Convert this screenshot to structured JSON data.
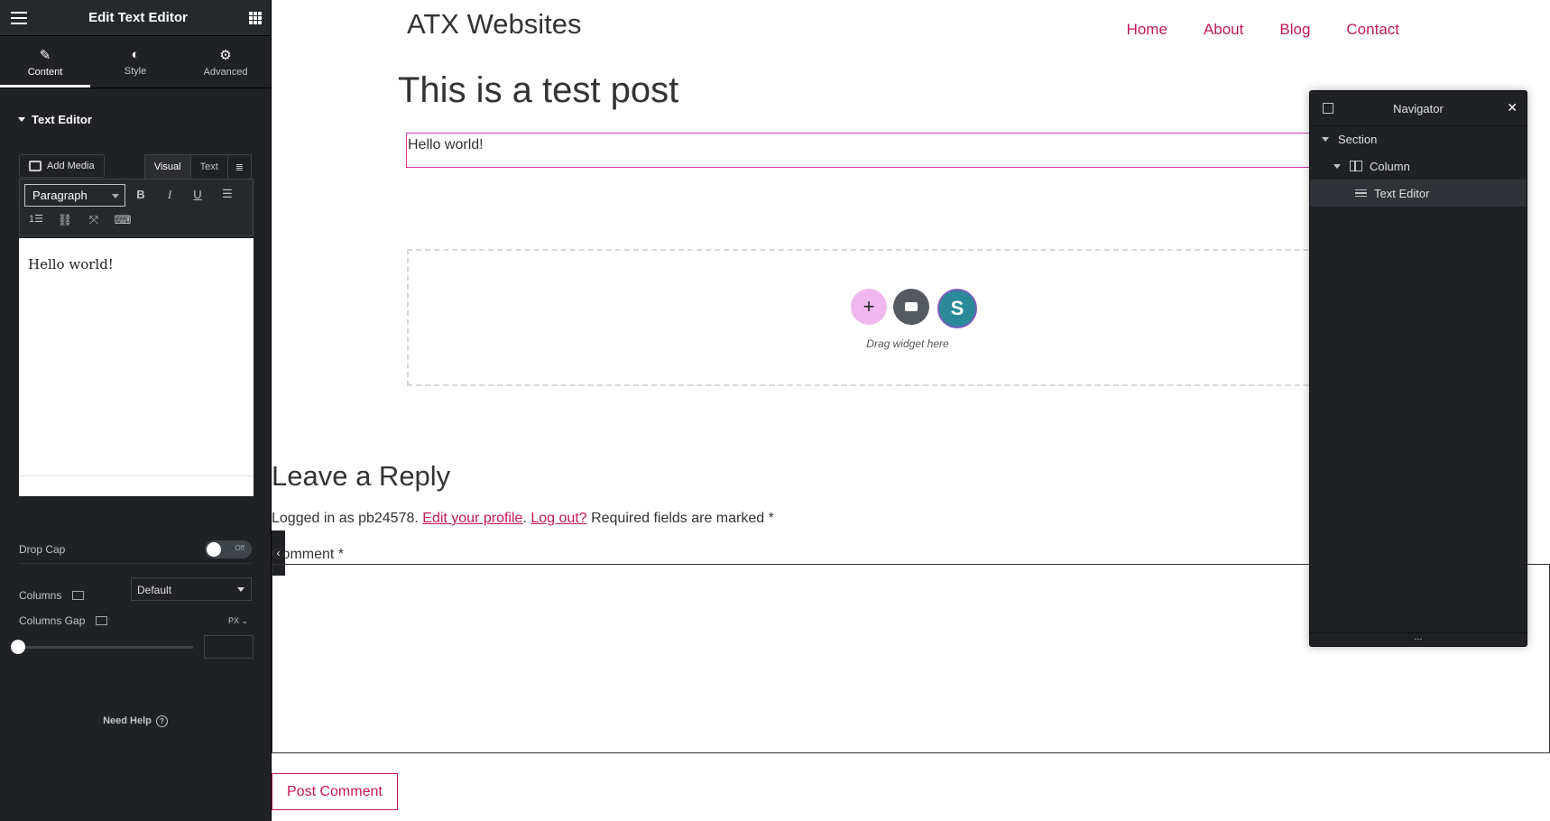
{
  "panel": {
    "title": "Edit Text Editor",
    "tabs": [
      {
        "label": "Content",
        "icon": "pencil-icon"
      },
      {
        "label": "Style",
        "icon": "half-circle-icon"
      },
      {
        "label": "Advanced",
        "icon": "gear-icon"
      }
    ],
    "section_title": "Text Editor",
    "add_media_label": "Add Media",
    "mode_tabs": [
      "Visual",
      "Text"
    ],
    "format_value": "Paragraph",
    "editor_content": "Hello world!",
    "drop_cap_label": "Drop Cap",
    "drop_cap_state": "Off",
    "columns_label": "Columns",
    "columns_value": "Default",
    "columns_gap_label": "Columns Gap",
    "columns_gap_unit": "PX",
    "columns_gap_value": "",
    "need_help": "Need Help"
  },
  "site": {
    "title": "ATX Websites",
    "nav": [
      "Home",
      "About",
      "Blog",
      "Contact"
    ],
    "accent": "#c2185b"
  },
  "post": {
    "title": "This is a test post",
    "text_widget": "Hello world!",
    "drag_label": "Drag widget here"
  },
  "reply": {
    "title": "Leave a Reply",
    "logged_prefix": "Logged in as pb24578.",
    "edit_profile": "Edit your profile",
    "log_out": "Log out?",
    "required_note": "Required fields are marked *",
    "comment_label": "Comment *",
    "submit_label": "Post Comment"
  },
  "navigator": {
    "title": "Navigator",
    "items": [
      "Section",
      "Column",
      "Text Editor"
    ],
    "footer": "..."
  }
}
